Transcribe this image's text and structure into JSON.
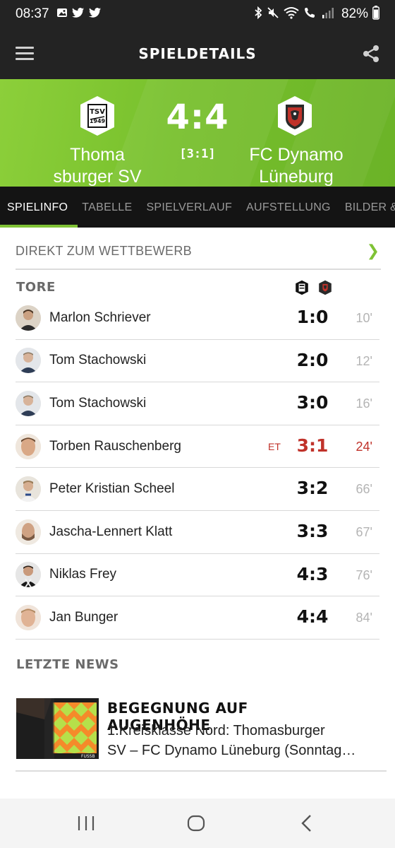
{
  "status_bar": {
    "time": "08:37",
    "battery": "82%",
    "left_icons": [
      "image-icon",
      "twitter-icon",
      "twitter-icon"
    ],
    "right_icons": [
      "bluetooth-icon",
      "mute-icon",
      "wifi-icon",
      "call-icon",
      "signal-icon"
    ]
  },
  "app_bar": {
    "title": "SPIELDETAILS"
  },
  "match": {
    "home_team": "Thoma\nsburger SV",
    "home_team_line1": "Thoma",
    "home_team_line2": "sburger SV",
    "away_team_line1": "FC Dynamo",
    "away_team_line2": "Lüneburg",
    "score": "4:4",
    "halftime": "[3:1]",
    "home_crest_text": "TSV",
    "home_crest_year": "1949"
  },
  "tabs": [
    {
      "label": "SPIELINFO",
      "active": true
    },
    {
      "label": "TABELLE",
      "active": false
    },
    {
      "label": "SPIELVERLAUF",
      "active": false
    },
    {
      "label": "AUFSTELLUNG",
      "active": false
    },
    {
      "label": "BILDER &",
      "active": false
    }
  ],
  "competition_link": {
    "label": "DIREKT ZUM WETTBEWERB",
    "chevron": "❯"
  },
  "goals_section": {
    "title": "TORE",
    "goals": [
      {
        "player": "Marlon Schriever",
        "score": "1:0",
        "minute": "10'",
        "own_goal": "",
        "highlight": false
      },
      {
        "player": "Tom Stachowski",
        "score": "2:0",
        "minute": "12'",
        "own_goal": "",
        "highlight": false
      },
      {
        "player": "Tom Stachowski",
        "score": "3:0",
        "minute": "16'",
        "own_goal": "",
        "highlight": false
      },
      {
        "player": "Torben Rauschenberg",
        "score": "3:1",
        "minute": "24'",
        "own_goal": "ET",
        "highlight": true
      },
      {
        "player": "Peter Kristian Scheel",
        "score": "3:2",
        "minute": "66'",
        "own_goal": "",
        "highlight": false
      },
      {
        "player": "Jascha-Lennert Klatt",
        "score": "3:3",
        "minute": "67'",
        "own_goal": "",
        "highlight": false
      },
      {
        "player": "Niklas Frey",
        "score": "4:3",
        "minute": "76'",
        "own_goal": "",
        "highlight": false
      },
      {
        "player": "Jan Bunger",
        "score": "4:4",
        "minute": "84'",
        "own_goal": "",
        "highlight": false
      }
    ]
  },
  "news_section": {
    "title": "LETZTE NEWS",
    "items": [
      {
        "headline": "BEGEGNUNG AUF AUGENHÖHE",
        "headline_line1": "BEGEGNUNG AUF",
        "headline_line2": "AUGENHÖHE",
        "teaser_line1": "1.Kreisklasse Nord: Thomasburger",
        "teaser_line2": "SV – FC Dynamo Lüneburg (Sonntag…",
        "thumb_caption": "FUSSB"
      }
    ]
  },
  "colors": {
    "accent_green": "#7fc235",
    "dark": "#232323",
    "red": "#c0322a"
  }
}
